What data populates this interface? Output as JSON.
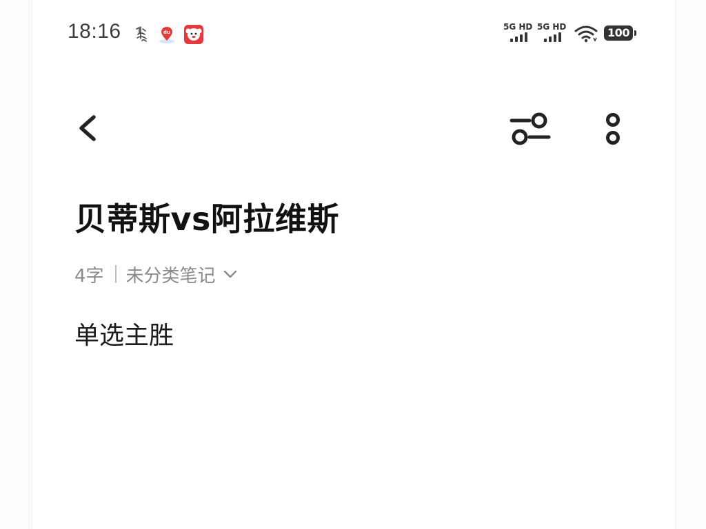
{
  "status_bar": {
    "time": "18:16",
    "signal_1_label": "5G HD",
    "signal_2_label": "5G HD",
    "battery_level": "100",
    "notification_icons": [
      "weather-icon",
      "baidu-maps-icon",
      "jd-app-icon"
    ]
  },
  "toolbar": {
    "back_icon": "chevron-left-icon",
    "filter_icon": "sliders-icon",
    "more_icon": "more-vertical-icon"
  },
  "note": {
    "title": "贝蒂斯vs阿拉维斯",
    "word_count": "4字",
    "category": "未分类笔记",
    "body": "单选主胜"
  },
  "colors": {
    "background": "#ffffff",
    "text_primary": "#111111",
    "text_secondary": "#8a8a8a",
    "jd_red": "#e4393c"
  }
}
